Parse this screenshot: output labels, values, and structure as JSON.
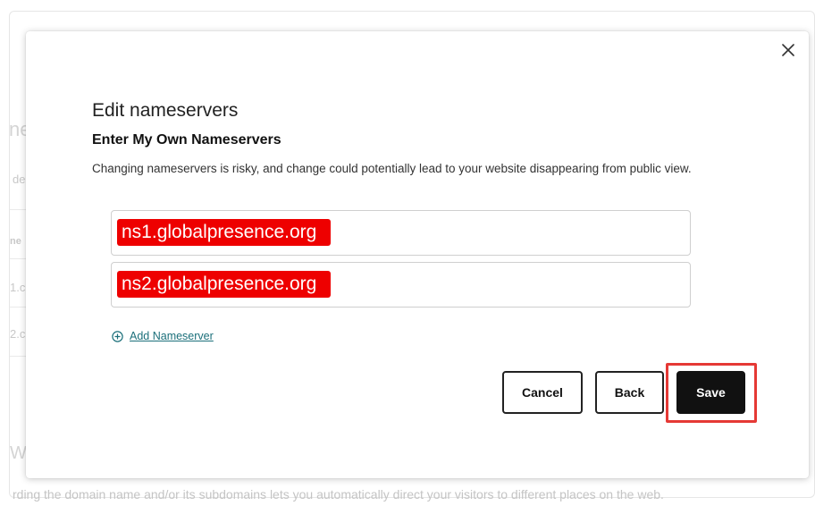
{
  "background": {
    "fragments": [
      "ne",
      "de",
      "ne",
      "1.c",
      "2.c",
      "W",
      "rding the domain name and/or its subdomains lets you automatically direct your visitors to different places on the web."
    ]
  },
  "modal": {
    "title": "Edit nameservers",
    "subtitle": "Enter My Own Nameservers",
    "description": "Changing nameservers is risky, and change could potentially lead to your website disappearing from public view.",
    "nameservers": [
      {
        "value": "ns1.globalpresence.org"
      },
      {
        "value": "ns2.globalpresence.org"
      }
    ],
    "add_nameserver_label": "Add Nameserver",
    "buttons": {
      "cancel": "Cancel",
      "back": "Back",
      "save": "Save"
    },
    "close_icon": "close-icon",
    "add_icon": "plus-circle-icon"
  },
  "colors": {
    "highlight": "#ee0000",
    "link": "#1b6f7a",
    "annotation_box": "#e53935",
    "primary_button": "#111111"
  }
}
